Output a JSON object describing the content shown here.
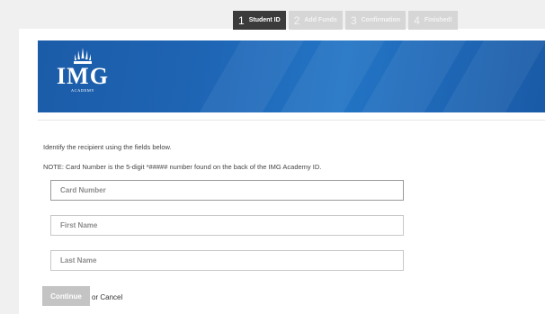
{
  "steps": [
    {
      "num": "1",
      "label": "Student ID"
    },
    {
      "num": "2",
      "label": "Add Funds"
    },
    {
      "num": "3",
      "label": "Confirmation"
    },
    {
      "num": "4",
      "label": "Finished!"
    }
  ],
  "logo": {
    "name": "IMG",
    "sub": "ACADEMY"
  },
  "instructions": {
    "line1": "Identify the recipient using the fields below.",
    "line2": "NOTE: Card Number is the 5-digit *##### number found on the back of the IMG Academy ID."
  },
  "form": {
    "card_number": {
      "placeholder": "Card Number",
      "value": ""
    },
    "first_name": {
      "placeholder": "First Name",
      "value": ""
    },
    "last_name": {
      "placeholder": "Last Name",
      "value": ""
    }
  },
  "actions": {
    "continue_label": "Continue",
    "or_text": "or",
    "cancel_label": "Cancel"
  },
  "colors": {
    "banner": "#1e64b3",
    "active_step": "#3b3b3b",
    "inactive_step": "#d6d6d6"
  }
}
